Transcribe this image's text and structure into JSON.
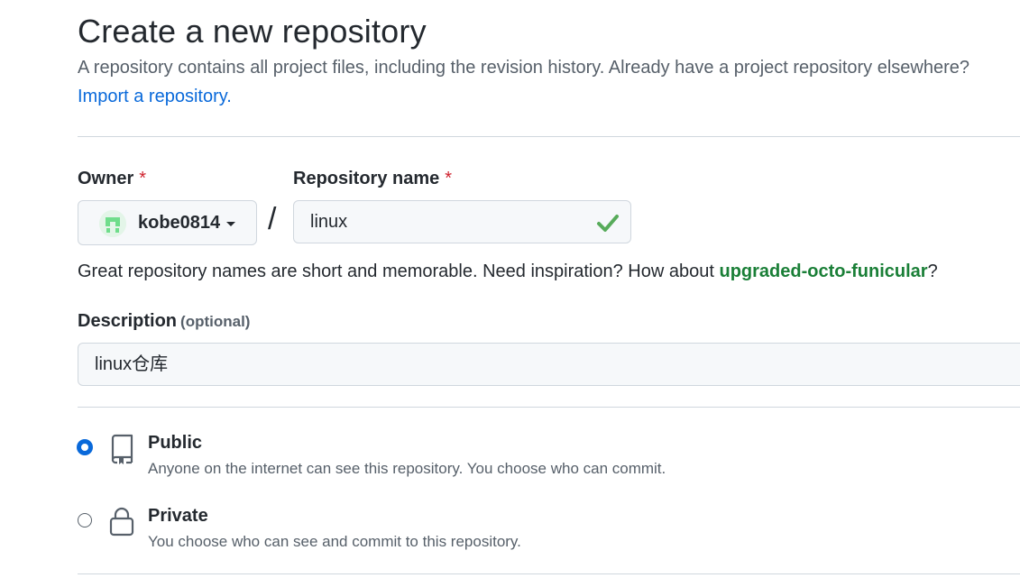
{
  "header": {
    "title": "Create a new repository",
    "subtitle": "A repository contains all project files, including the revision history. Already have a project repository elsewhere?",
    "import_link": "Import a repository."
  },
  "owner": {
    "label": "Owner",
    "required_mark": "*",
    "value": "kobe0814",
    "avatar_icon": "identicon-avatar",
    "avatar_color": "#6fdd8b"
  },
  "separator": "/",
  "repo_name": {
    "label": "Repository name",
    "required_mark": "*",
    "value": "linux",
    "status_icon": "check-icon",
    "status_color": "#57ab5a"
  },
  "name_hint": {
    "prefix": "Great repository names are short and memorable. Need inspiration? How about ",
    "suggestion": "upgraded-octo-funicular",
    "suffix": "?"
  },
  "description": {
    "label": "Description",
    "optional": "(optional)",
    "value": "linux仓库"
  },
  "visibility": {
    "selected": "public",
    "options": [
      {
        "id": "public",
        "icon": "repo-icon",
        "title": "Public",
        "description": "Anyone on the internet can see this repository. You choose who can commit."
      },
      {
        "id": "private",
        "icon": "lock-icon",
        "title": "Private",
        "description": "You choose who can see and commit to this repository."
      }
    ]
  },
  "colors": {
    "link": "#0969da",
    "suggestion": "#1a7f37",
    "required": "#cf222e",
    "radio_checked": "#0969da"
  }
}
